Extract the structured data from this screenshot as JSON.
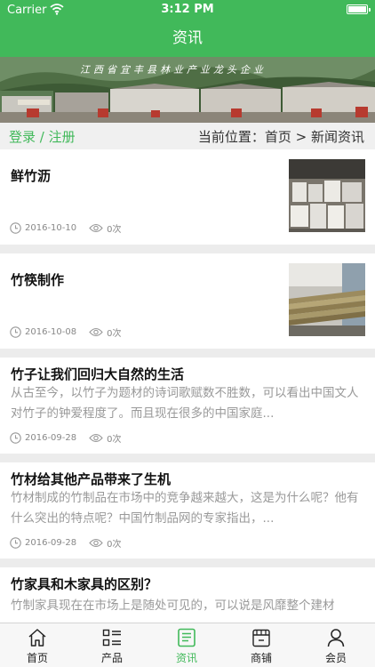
{
  "status": {
    "carrier": "Carrier",
    "time": "3:12 PM"
  },
  "nav": {
    "title": "资讯"
  },
  "banner": {
    "slogan": "江西省宜丰县林业产业龙头企业"
  },
  "login_bar": {
    "login": "登录 / 注册",
    "breadcrumb": "当前位置：首页 > 新闻资讯"
  },
  "articles": [
    {
      "title": "鲜竹沥",
      "date": "2016-10-10",
      "views": "0次"
    },
    {
      "title": "竹筷制作",
      "date": "2016-10-08",
      "views": "0次"
    },
    {
      "title": "竹子让我们回归大自然的生活",
      "summary": "从古至今，以竹子为题材的诗词歌赋数不胜数，可以看出中国文人对竹子的钟爱程度了。而且现在很多的中国家庭...",
      "date": "2016-09-28",
      "views": "0次"
    },
    {
      "title": "竹材给其他产品带来了生机",
      "summary": "竹材制成的竹制品在市场中的竞争越来越大，这是为什么呢？他有什么突出的特点呢？中国竹制品网的专家指出，...",
      "date": "2016-09-28",
      "views": "0次"
    },
    {
      "title": "竹家具和木家具的区别？",
      "summary": "竹制家具现在在市场上是随处可见的，可以说是风靡整个建材",
      "date": "",
      "views": ""
    }
  ],
  "tabs": [
    {
      "label": "首页",
      "icon": "home-icon"
    },
    {
      "label": "产品",
      "icon": "grid-list-icon"
    },
    {
      "label": "资讯",
      "icon": "news-icon",
      "active": true
    },
    {
      "label": "商铺",
      "icon": "store-icon"
    },
    {
      "label": "会员",
      "icon": "user-icon"
    }
  ],
  "colors": {
    "brand": "#41b95a",
    "background": "#ececec"
  }
}
